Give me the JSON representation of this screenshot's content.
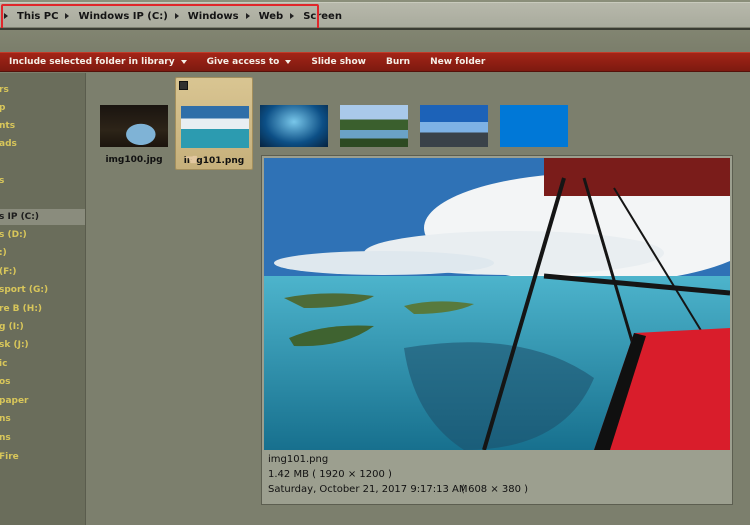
{
  "address_bar": {
    "breadcrumbs": [
      "This PC",
      "Windows IP (C:)",
      "Windows",
      "Web",
      "Screen"
    ]
  },
  "command_bar": {
    "items": [
      {
        "label": "Include selected folder in library",
        "dropdown": true
      },
      {
        "label": "Give access to",
        "dropdown": true
      },
      {
        "label": "Slide show",
        "dropdown": false
      },
      {
        "label": "Burn",
        "dropdown": false
      },
      {
        "label": "New folder",
        "dropdown": false
      }
    ]
  },
  "nav_pane": {
    "items": [
      "rs",
      "p",
      "nts",
      "ads",
      "s",
      "s IP (C:)",
      "s (D:)",
      ":)",
      "(F:)",
      "sport (G:)",
      "re B (H:)",
      "g (I:)",
      "sk (J:)",
      "ic",
      "os",
      "paper",
      "ns",
      "ns",
      "Fire"
    ],
    "selected": "s IP (C:)"
  },
  "files": [
    {
      "name": "img100.jpg",
      "thumb": "cave"
    },
    {
      "name": "img101.png",
      "thumb": "sky",
      "selected": true
    },
    {
      "name": "",
      "thumb": "blue"
    },
    {
      "name": "",
      "thumb": "lake"
    },
    {
      "name": "",
      "thumb": "cloud"
    },
    {
      "name": "",
      "thumb": "solid"
    }
  ],
  "preview": {
    "filename": "img101.png",
    "size_dims": "1.42 MB    ( 1920 × 1200 )",
    "date_line": "Saturday, October 21, 2017 9:17:13 AM",
    "overlap_dims": "( 608 × 380 )"
  },
  "colors": {
    "command_bar": "#9b2216",
    "nav_text": "#d8c65a",
    "highlight_box": "#e0262a",
    "window_bg": "#7c7f6d"
  }
}
